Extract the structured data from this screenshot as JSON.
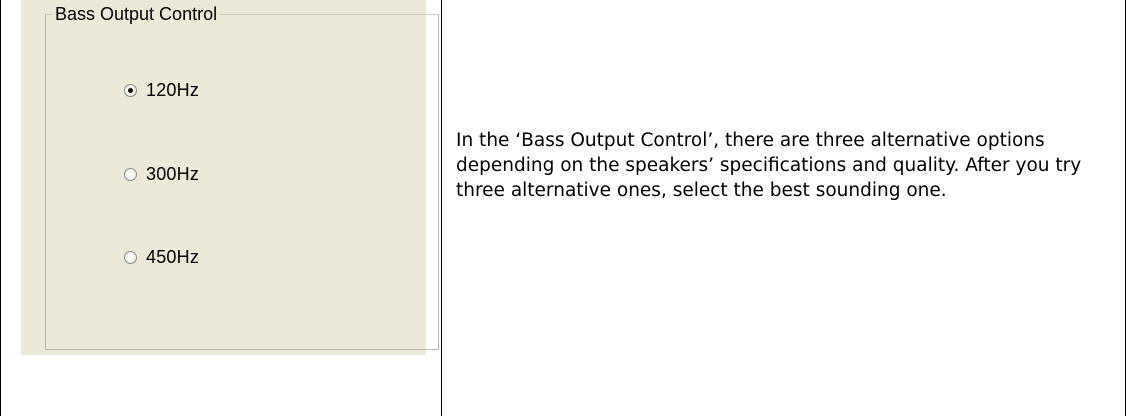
{
  "bass_control": {
    "title": "Bass Output Control",
    "options": [
      {
        "label": "120Hz",
        "checked": true
      },
      {
        "label": "300Hz",
        "checked": false
      },
      {
        "label": "450Hz",
        "checked": false
      }
    ],
    "selected": "120Hz"
  },
  "description": {
    "text": "In the ‘Bass Output Control’, there are three alternative options depending on the speakers’ specifications and quality. After you try three alternative ones, select the best sounding one."
  },
  "colors": {
    "dialog_background": "#ECE9D8",
    "groupbox_border": "#BAB7A8",
    "table_border": "#000000"
  }
}
